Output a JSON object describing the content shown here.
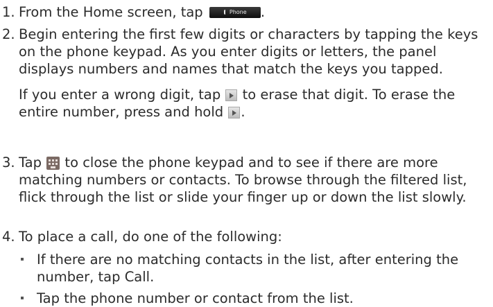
{
  "steps": [
    {
      "number": "1.",
      "text_before": "From the Home screen, tap",
      "icon": "phone-button",
      "icon_label": "Phone",
      "text_after": "."
    },
    {
      "number": "2.",
      "paragraph1": "Begin entering the first few digits or characters by tapping the keys on the phone keypad. As you enter digits or letters, the panel displays numbers and names that match the keys you tapped.",
      "p2_a": "If you enter a wrong digit, tap",
      "p2_b": "to erase that digit. To erase the entire number, press and hold",
      "p2_c": ".",
      "icon": "backspace-icon"
    },
    {
      "number": "3.",
      "text_before": "Tap",
      "icon": "keypad-icon",
      "text_after": "to close the phone keypad and to see if there are more matching numbers or contacts. To browse through the filtered list, flick through the list or slide your finger up or down the list slowly."
    },
    {
      "number": "4.",
      "text": "To place a call, do one of the following:"
    }
  ],
  "bullets": [
    {
      "text_before": "If there are no matching contacts in the list, after entering the number, tap",
      "emphasis": "Call",
      "text_after": "."
    },
    {
      "text": "Tap the phone number or contact from the list."
    }
  ]
}
